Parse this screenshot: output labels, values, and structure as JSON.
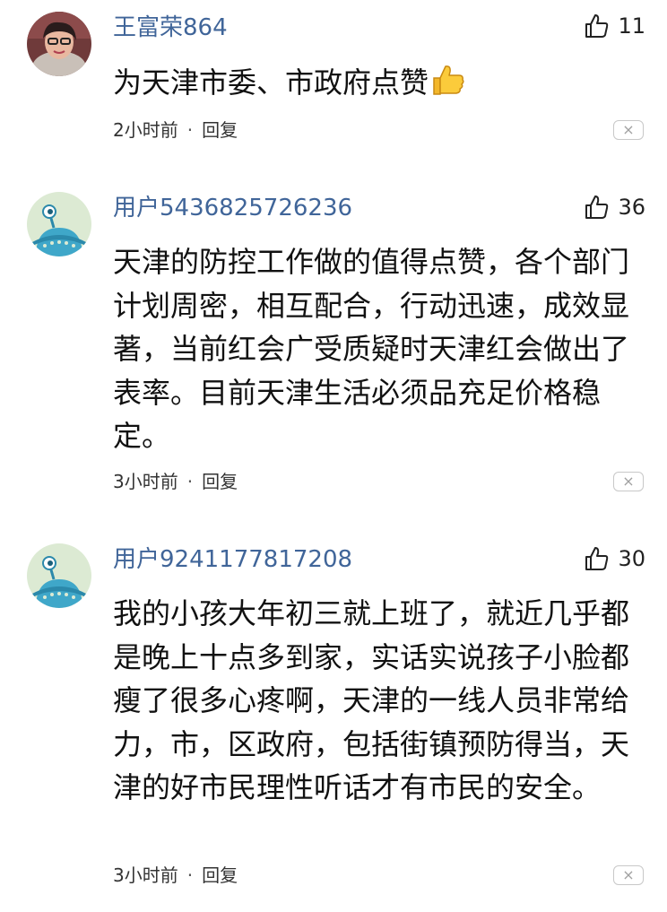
{
  "comments": [
    {
      "username": "王富荣864",
      "likes": "11",
      "text": "为天津市委、市政府点赞",
      "time": "2小时前",
      "separator": "·",
      "reply": "回复",
      "close": "×"
    },
    {
      "username": "用户5436825726236",
      "likes": "36",
      "text": "天津的防控工作做的值得点赞，各个部门计划周密，相互配合，行动迅速，成效显著，当前红会广受质疑时天津红会做出了表率。目前天津生活必须品充足价格稳定。",
      "time": "3小时前",
      "separator": "·",
      "reply": "回复",
      "close": "×"
    },
    {
      "username": "用户9241177817208",
      "likes": "30",
      "text": "我的小孩大年初三就上班了，就近几乎都是晚上十点多到家，实话实说孩子小脸都瘦了很多心疼啊，天津的一线人员非常给力，市，区政府，包括街镇预防得当，天津的好市民理性听话才有市民的安全。",
      "time": "3小时前",
      "separator": "·",
      "reply": "回复",
      "close": "×"
    }
  ],
  "colors": {
    "username": "#406599",
    "text": "#111111",
    "meta": "#333333"
  },
  "icons": {
    "like": "thumbs-up-outline-icon",
    "emoji": "thumbs-up-emoji-icon",
    "close": "close-icon"
  }
}
